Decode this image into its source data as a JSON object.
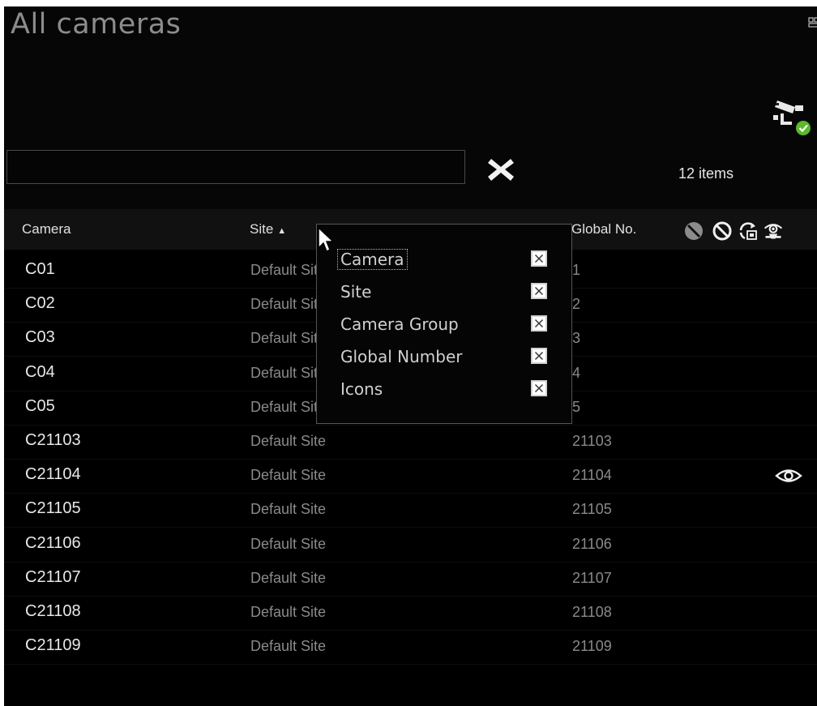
{
  "page": {
    "title": "All cameras"
  },
  "search": {
    "value": "",
    "placeholder": ""
  },
  "toolbar": {
    "clear_icon": "x-icon",
    "items_count": "12 items",
    "status_icon": "camera-status-icon"
  },
  "grid": {
    "columns": {
      "camera": "Camera",
      "site": "Site",
      "site_sort": "▲",
      "global_number": "Global No."
    },
    "header_icons": [
      "disabled-icon",
      "blocked-icon",
      "patrol-icon",
      "privacy-icon"
    ],
    "rows": [
      {
        "camera": "C01",
        "site": "Default Site",
        "number": "1",
        "icon": ""
      },
      {
        "camera": "C02",
        "site": "Default Site",
        "number": "2",
        "icon": ""
      },
      {
        "camera": "C03",
        "site": "Default Site",
        "number": "3",
        "icon": ""
      },
      {
        "camera": "C04",
        "site": "Default Site",
        "number": "4",
        "icon": ""
      },
      {
        "camera": "C05",
        "site": "Default Site",
        "number": "5",
        "icon": ""
      },
      {
        "camera": "C21103",
        "site": "Default Site",
        "number": "21103",
        "icon": ""
      },
      {
        "camera": "C21104",
        "site": "Default Site",
        "number": "21104",
        "icon": "eye-icon"
      },
      {
        "camera": "C21105",
        "site": "Default Site",
        "number": "21105",
        "icon": ""
      },
      {
        "camera": "C21106",
        "site": "Default Site",
        "number": "21106",
        "icon": ""
      },
      {
        "camera": "C21107",
        "site": "Default Site",
        "number": "21107",
        "icon": ""
      },
      {
        "camera": "C21108",
        "site": "Default Site",
        "number": "21108",
        "icon": ""
      },
      {
        "camera": "C21109",
        "site": "Default Site",
        "number": "21109",
        "icon": ""
      }
    ]
  },
  "column_chooser": {
    "items": [
      {
        "label": "Camera",
        "checked": true
      },
      {
        "label": "Site",
        "checked": true
      },
      {
        "label": "Camera Group",
        "checked": true
      },
      {
        "label": "Global Number",
        "checked": true
      },
      {
        "label": "Icons",
        "checked": true
      }
    ]
  },
  "colors": {
    "background": "#060606",
    "header": "#111111",
    "status_ok": "#5cb82e",
    "text_primary": "#e8e8e8",
    "text_secondary": "#8a8a8a"
  }
}
